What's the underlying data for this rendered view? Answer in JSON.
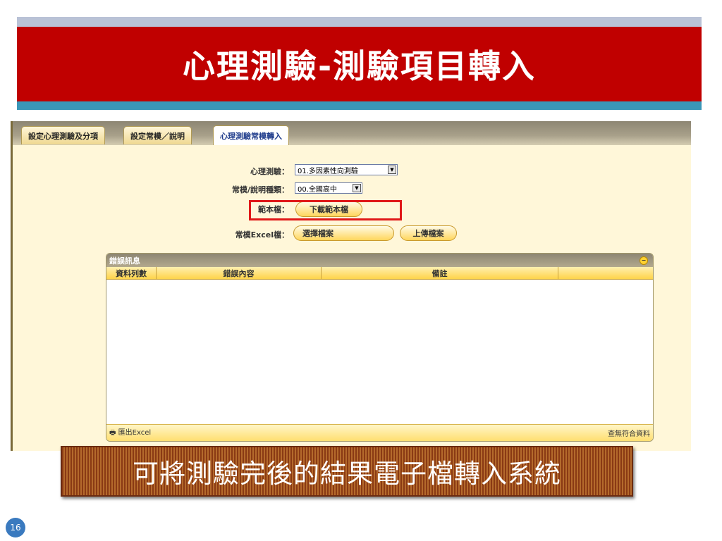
{
  "slide": {
    "title": "心理測驗-測驗項目轉入",
    "caption": "可將測驗完後的結果電子檔轉入系統",
    "page_number": "16"
  },
  "tabs": [
    {
      "label": "設定心理測驗及分項",
      "active": false
    },
    {
      "label": "設定常模／說明",
      "active": false
    },
    {
      "label": "心理測驗常模轉入",
      "active": true
    }
  ],
  "form": {
    "test_label": "心理測驗：",
    "test_value": "01.多因素性向測驗",
    "norm_label": "常模/說明種類：",
    "norm_value": "00.全國高中",
    "template_label": "範本檔：",
    "template_button": "下載範本檔",
    "excel_label": "常模Excel檔：",
    "choose_file_button": "選擇檔案",
    "upload_button": "上傳檔案"
  },
  "error_panel": {
    "title": "錯誤訊息",
    "columns": [
      "資料列數",
      "錯誤內容",
      "備註",
      ""
    ],
    "rows": [],
    "export_label": "匯出Excel",
    "status_text": "查無符合資料"
  },
  "colors": {
    "title_banner": "#c00000",
    "accent_stripe": "#3a97b8",
    "highlight_box": "#e01818"
  }
}
